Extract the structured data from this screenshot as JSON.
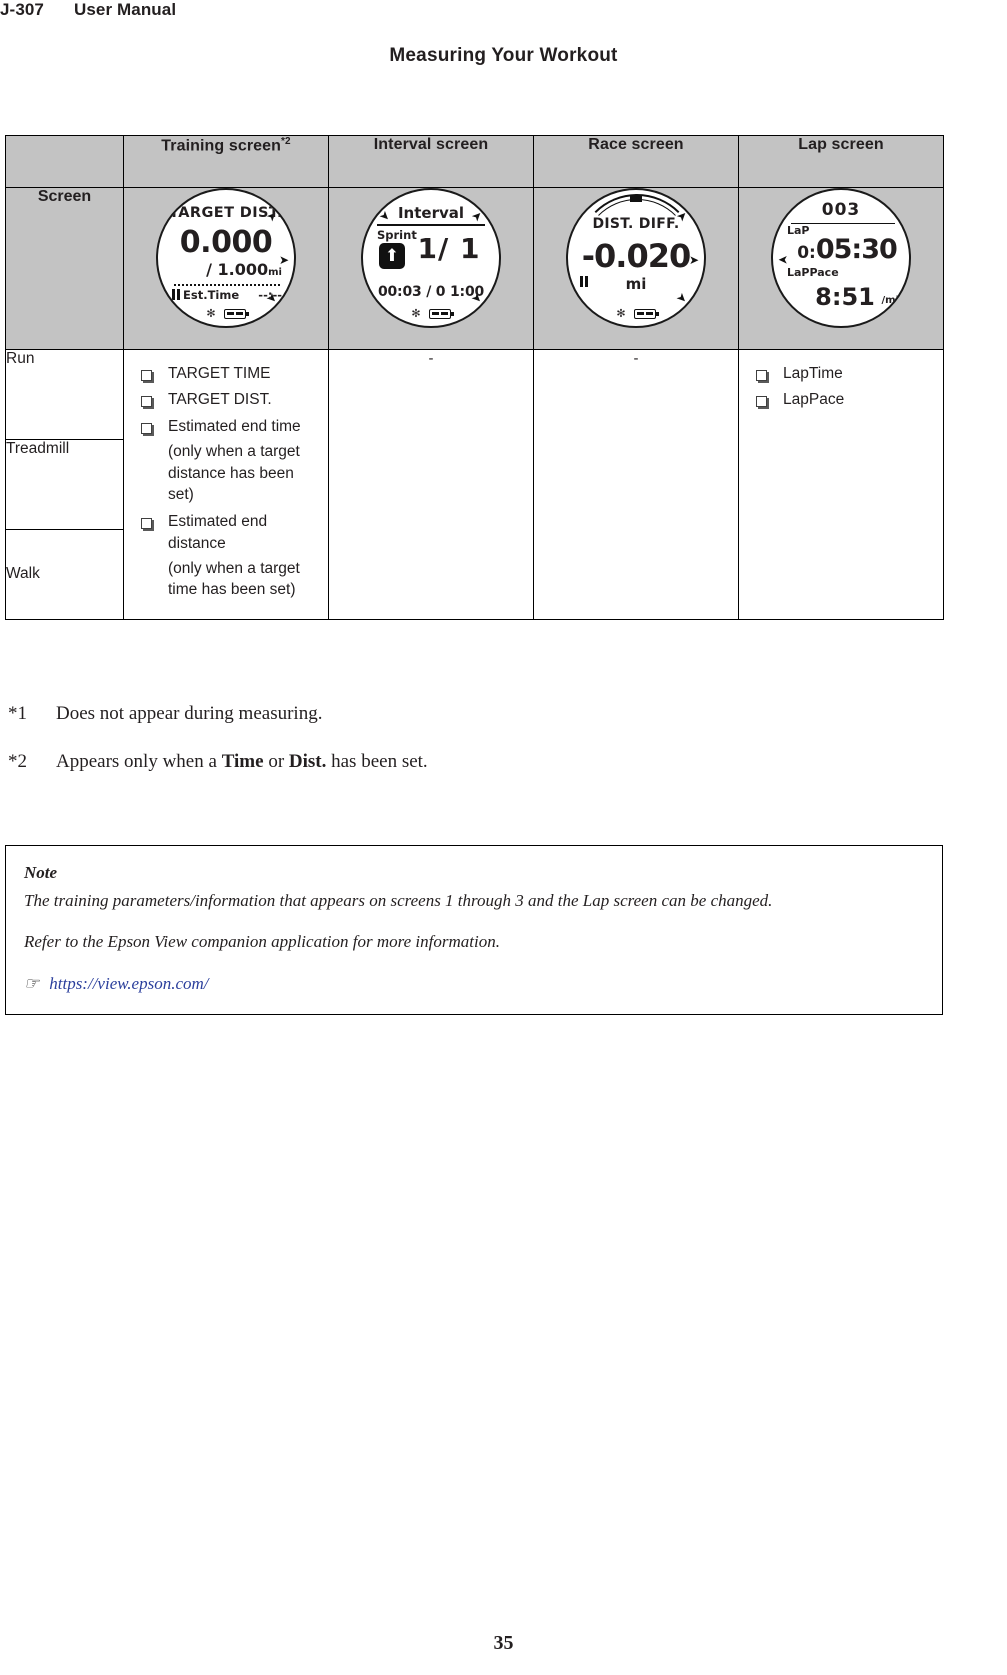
{
  "header": {
    "model": "J-307",
    "manual": "User Manual",
    "section_title": "Measuring Your Workout"
  },
  "table": {
    "row_label_header": "",
    "columns": [
      {
        "label": "Training screen",
        "sup": "*2"
      },
      {
        "label": "Interval screen",
        "sup": ""
      },
      {
        "label": "Race screen",
        "sup": ""
      },
      {
        "label": "Lap screen",
        "sup": ""
      }
    ],
    "screen_row_label": "Screen",
    "watches": [
      {
        "name": "training-screen-watch",
        "title": "TARGET DIST.",
        "value": "0.000",
        "target": "/ 1.000",
        "unit": "mi",
        "foot_label": "Est.Time",
        "foot_value": "--:--"
      },
      {
        "name": "interval-screen-watch",
        "title": "Interval",
        "phase": "Sprint",
        "count": "1/ 1",
        "elapsed": "00:03  / 0 1:00"
      },
      {
        "name": "race-screen-watch",
        "title": "DIST. DIFF.",
        "value": "-0.020",
        "unit": "mi"
      },
      {
        "name": "lap-screen-watch",
        "lap_number": "003",
        "lap_label": "LaP",
        "lap_time_prefix": "0:",
        "lap_time": "05:30",
        "lap_pace_label": "LaPPace",
        "lap_pace": "8:51",
        "lap_pace_unit": "/mi"
      }
    ],
    "modes": [
      "Run",
      "Treadmill",
      "Walk"
    ],
    "training_items": [
      {
        "type": "check",
        "text": "TARGET TIME"
      },
      {
        "type": "check",
        "text": "TARGET DIST."
      },
      {
        "type": "check",
        "text": "Estimated end time"
      },
      {
        "type": "sub",
        "text": "(only when a target distance has been set)"
      },
      {
        "type": "check",
        "text": "Estimated end distance"
      },
      {
        "type": "sub",
        "text": "(only when a target time has been set)"
      }
    ],
    "interval_value": "-",
    "race_value": "-",
    "lap_items": [
      {
        "type": "check",
        "text": "LapTime"
      },
      {
        "type": "check",
        "text": "LapPace"
      }
    ]
  },
  "footnotes": [
    {
      "mark": "*1",
      "text": "Does not appear during measuring."
    },
    {
      "mark": "*2",
      "pre": "Appears only when a ",
      "b1": "Time",
      "mid": " or ",
      "b2": "Dist.",
      "post": " has been set."
    }
  ],
  "note": {
    "heading": "Note",
    "line1": "The training parameters/information that appears on screens 1 through 3 and the Lap screen can be changed.",
    "line2": "Refer to the Epson View companion application for more information.",
    "link": "https://view.epson.com/"
  },
  "page_number": "35",
  "colors": {
    "header_fill": "#c3c3c3",
    "text": "#231f20",
    "link": "#2b3f9c"
  }
}
